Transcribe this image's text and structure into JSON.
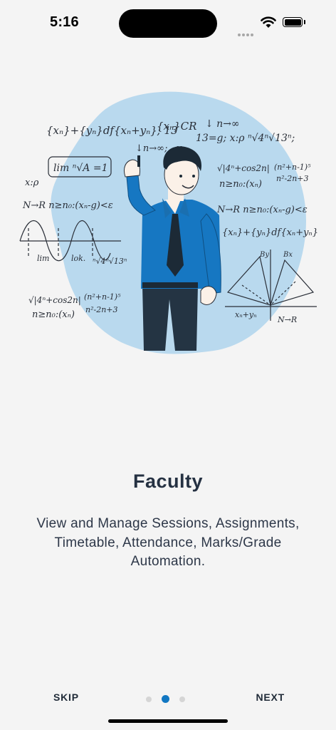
{
  "status_bar": {
    "time": "5:16",
    "icons": [
      "signal-dots-icon",
      "wifi-icon",
      "battery-icon"
    ]
  },
  "onboarding": {
    "title": "Faculty",
    "description": "View and Manage Sessions, Assignments, Timetable, Attendance, Marks/Grade Automation.",
    "illustration_icon": "teacher-writing-math-illustration"
  },
  "navigation": {
    "skip_label": "SKIP",
    "next_label": "NEXT",
    "page_count": 3,
    "current_page": 2
  },
  "colors": {
    "background": "#f4f4f4",
    "blob": "#b9d9ee",
    "accent": "#1177c2",
    "text_dark": "#253142"
  }
}
